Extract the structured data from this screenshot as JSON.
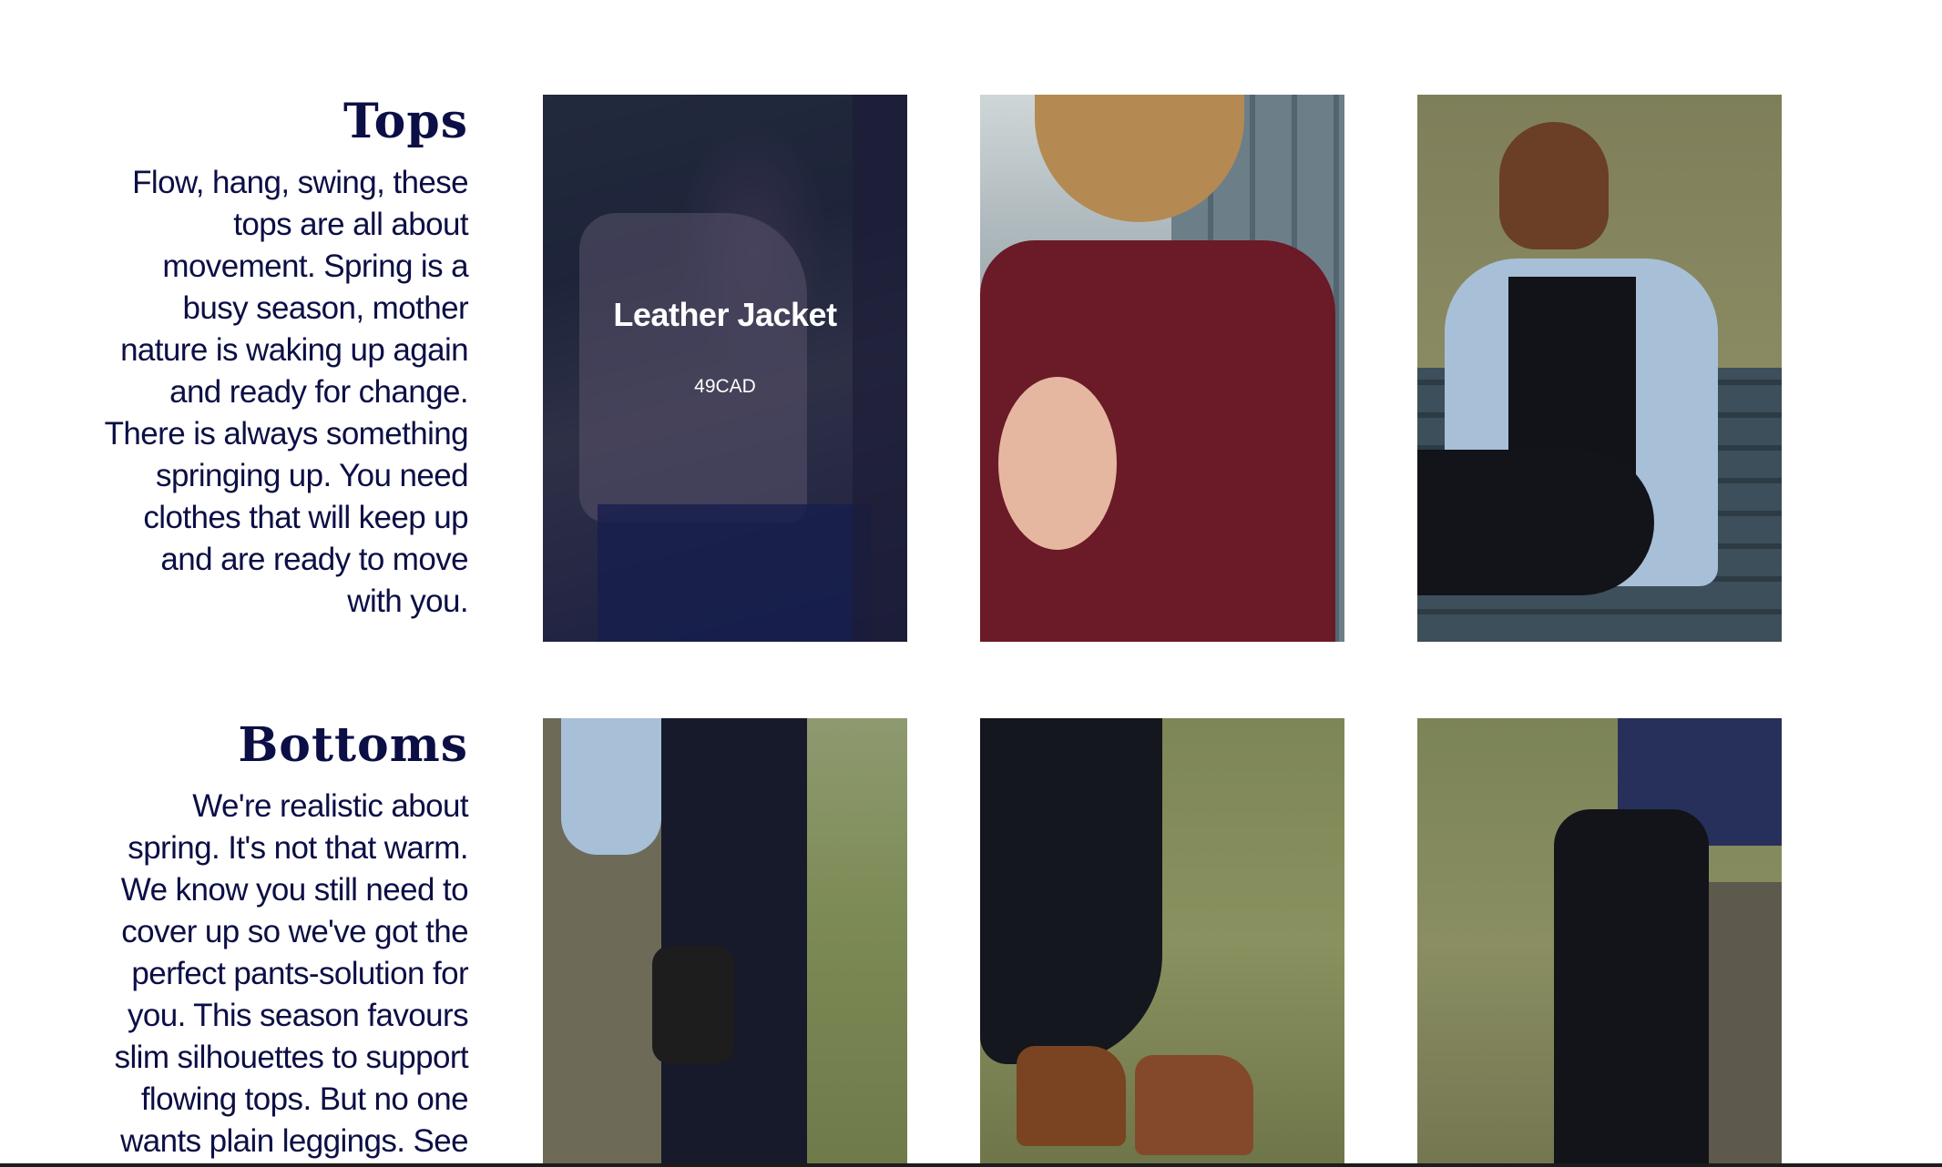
{
  "sections": {
    "tops": {
      "heading": "Tops",
      "description": "Flow, hang, swing, these tops are all about movement. Spring is a busy season, mother nature is waking up again and ready for change. There is always something springing up. You need clothes that will keep up and are ready to move with you.",
      "products": [
        {
          "name": "Leather Jacket",
          "price": "49CAD"
        }
      ]
    },
    "bottoms": {
      "heading": "Bottoms",
      "description": "We're realistic about spring. It's not that warm. We know you still need to cover up so we've got the perfect pants-solution for you. This season favours slim silhouettes to support flowing tops. But no one wants plain leggings. See"
    }
  },
  "colors": {
    "heading": "#0c0f45",
    "body_text": "#0c0f45",
    "hover_overlay": "#141646",
    "background": "#ffffff"
  }
}
